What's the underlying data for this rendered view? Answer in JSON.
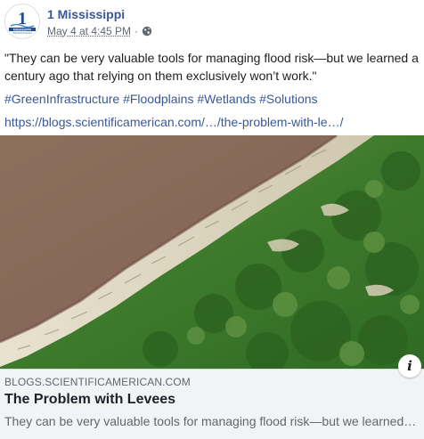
{
  "post": {
    "page_name": "1 Mississippi",
    "timestamp": "May 4 at 4:45 PM",
    "separator": "·",
    "privacy_icon": "globe-icon",
    "quote": "\"They can be very valuable tools for managing flood risk—but we learned a century ago that relying on them exclusively won’t work.\"",
    "hashtags": [
      "#GreenInfrastructure",
      "#Floodplains",
      "#Wetlands",
      "#Solutions"
    ],
    "link_text": "https://blogs.scientificamerican.com/…/the-problem-with-le…/"
  },
  "avatar": {
    "logo_text": "MISSISSIPPI",
    "logo_numeral": "1"
  },
  "preview": {
    "domain": "BLOGS.SCIENTIFICAMERICAN.COM",
    "title": "The Problem with Levees",
    "description": "They can be very valuable tools for managing flood risk—but we learned a century ago that relying on them exclusively won’t work.",
    "info_label": "i"
  },
  "colors": {
    "link": "#385898",
    "river": "#8a6b5a",
    "forest": "#3f7a2e",
    "preview_bg": "#f2f3f5"
  }
}
